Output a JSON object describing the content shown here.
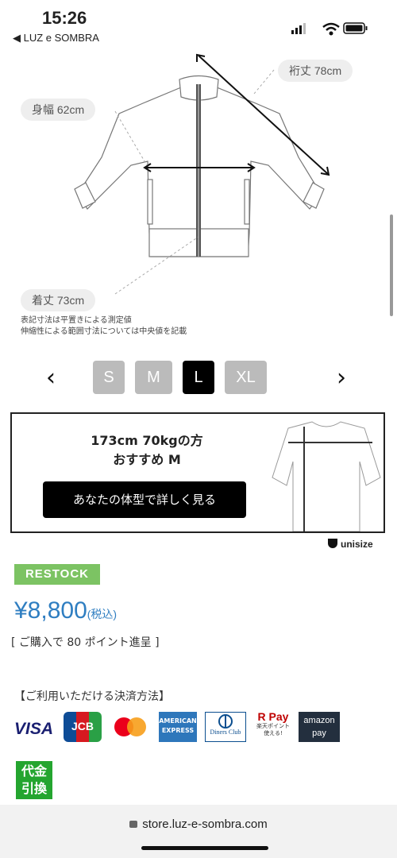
{
  "status": {
    "time": "15:26",
    "back_label": "◀ LUZ e SOMBRA"
  },
  "measurements": {
    "sleeve": "裄丈 78cm",
    "width": "身幅 62cm",
    "length": "着丈 73cm",
    "note1": "表記寸法は平置きによる測定値",
    "note2": "伸縮性による範囲寸法については中央値を記載"
  },
  "sizes": {
    "prev": "‹",
    "next": "›",
    "items": [
      "S",
      "M",
      "L",
      "XL"
    ],
    "selected": "L"
  },
  "recommend": {
    "line1": "173cm 70kgの方",
    "line2": "おすすめ M",
    "button": "あなたの体型で詳しく見る",
    "brand": "unisize"
  },
  "product": {
    "badge": "RESTOCK",
    "price": "¥8,800",
    "tax": "(税込)",
    "points": "[ ご購入で 80 ポイント進呈 ]"
  },
  "payment": {
    "title": "【ご利用いただける決済方法】",
    "visa": "VISA",
    "jcb": "JCB",
    "amex": "AMERICAN EXPRESS",
    "diners": "Diners Club",
    "rpay": "R Pay",
    "rpay_sub": "楽天ポイント使える!",
    "amazon": "amazon pay",
    "cod": "代金引換"
  },
  "browser": {
    "url": "store.luz-e-sombra.com"
  },
  "colors": {
    "accent_price": "#2f7ec1",
    "restock": "#7cc363",
    "cod": "#24a52f"
  }
}
